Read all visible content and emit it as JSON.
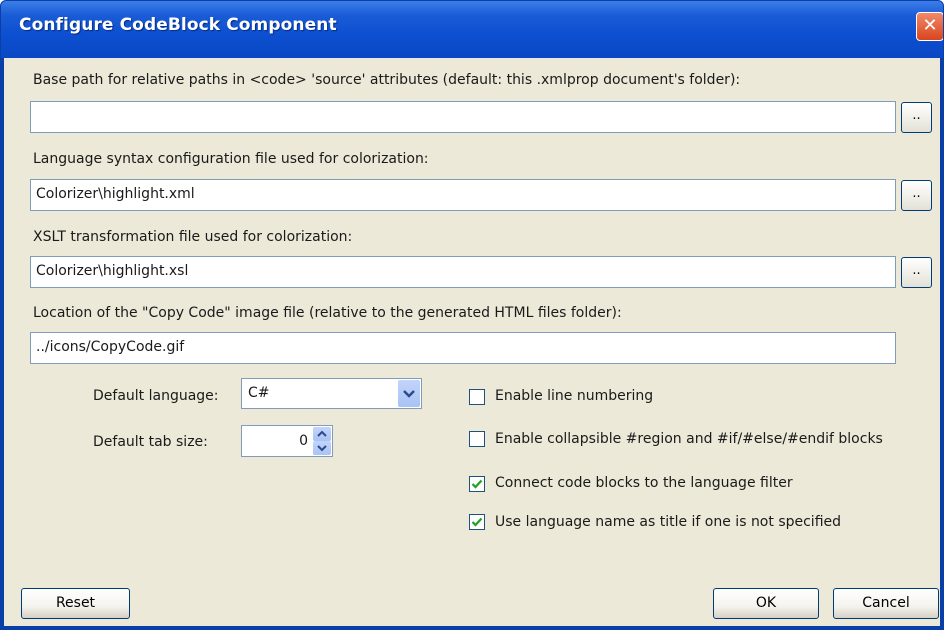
{
  "window": {
    "title": "Configure CodeBlock Component",
    "close_label": "✕"
  },
  "fields": {
    "base_path": {
      "label": "Base path for relative paths in <code> 'source' attributes (default: this .xmlprop document's folder):",
      "value": "",
      "browse_label": ".."
    },
    "syntax_file": {
      "label": "Language syntax configuration file used for colorization:",
      "value": "Colorizer\\highlight.xml",
      "browse_label": ".."
    },
    "xslt_file": {
      "label": "XSLT transformation file used for colorization:",
      "value": "Colorizer\\highlight.xsl",
      "browse_label": ".."
    },
    "copy_image": {
      "label": "Location of the \"Copy Code\" image file (relative to the generated HTML files folder):",
      "value": "../icons/CopyCode.gif"
    }
  },
  "default_language": {
    "label": "Default language:",
    "value": "C#"
  },
  "default_tab_size": {
    "label": "Default tab size:",
    "value": "0"
  },
  "options": [
    {
      "label": "Enable line numbering",
      "checked": false
    },
    {
      "label": "Enable collapsible #region and #if/#else/#endif blocks",
      "checked": false
    },
    {
      "label": "Connect code blocks to the language filter",
      "checked": true
    },
    {
      "label": "Use language name as title if one is not specified",
      "checked": true
    }
  ],
  "buttons": {
    "reset": "Reset",
    "ok": "OK",
    "cancel": "Cancel"
  },
  "colors": {
    "title_bar": "#0a47c4",
    "dialog_bg": "#ece9d8",
    "check_mark": "#21a121"
  }
}
